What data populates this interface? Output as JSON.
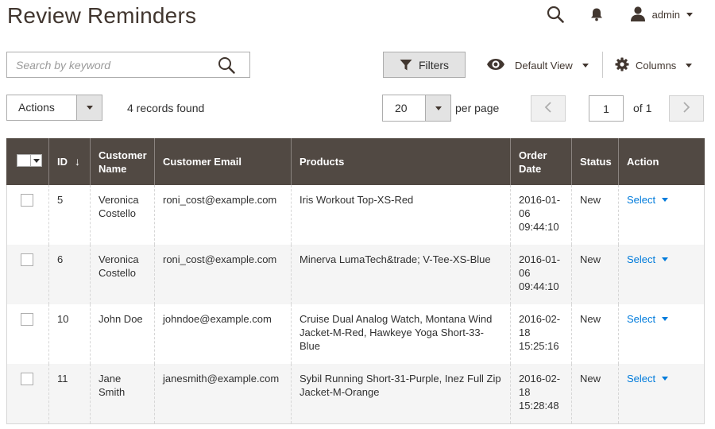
{
  "page": {
    "title": "Review Reminders"
  },
  "header": {
    "search_icon": "search-icon",
    "notifications_icon": "bell-icon",
    "user": {
      "icon": "user-icon",
      "name": "admin"
    }
  },
  "toolbar": {
    "search": {
      "placeholder": "Search by keyword",
      "value": ""
    },
    "filters_label": "Filters",
    "view_label": "Default View",
    "columns_label": "Columns",
    "actions_label": "Actions",
    "records_found": "4 records found",
    "per_page_value": "20",
    "per_page_label": "per page",
    "current_page": "1",
    "total_pages_label": "of 1"
  },
  "grid": {
    "columns": [
      "ID",
      "Customer Name",
      "Customer Email",
      "Products",
      "Order Date",
      "Status",
      "Action"
    ],
    "rows": [
      {
        "id": "5",
        "name": "Veronica Costello",
        "email": "roni_cost@example.com",
        "products": "Iris Workout Top-XS-Red",
        "date": "2016-01-06 09:44:10",
        "status": "New",
        "action": "Select"
      },
      {
        "id": "6",
        "name": "Veronica Costello",
        "email": "roni_cost@example.com",
        "products": "Minerva LumaTech&trade; V-Tee-XS-Blue",
        "date": "2016-01-06 09:44:10",
        "status": "New",
        "action": "Select"
      },
      {
        "id": "10",
        "name": "John Doe",
        "email": "johndoe@example.com",
        "products": "Cruise Dual Analog Watch, Montana Wind Jacket-M-Red, Hawkeye Yoga Short-33-Blue",
        "date": "2016-02-18 15:25:16",
        "status": "New",
        "action": "Select"
      },
      {
        "id": "11",
        "name": "Jane Smith",
        "email": "janesmith@example.com",
        "products": "Sybil Running Short-31-Purple, Inez Full Zip Jacket-M-Orange",
        "date": "2016-02-18 15:28:48",
        "status": "New",
        "action": "Select"
      }
    ]
  },
  "colors": {
    "header_bg": "#514943",
    "link": "#007bdb",
    "title": "#41362f"
  }
}
